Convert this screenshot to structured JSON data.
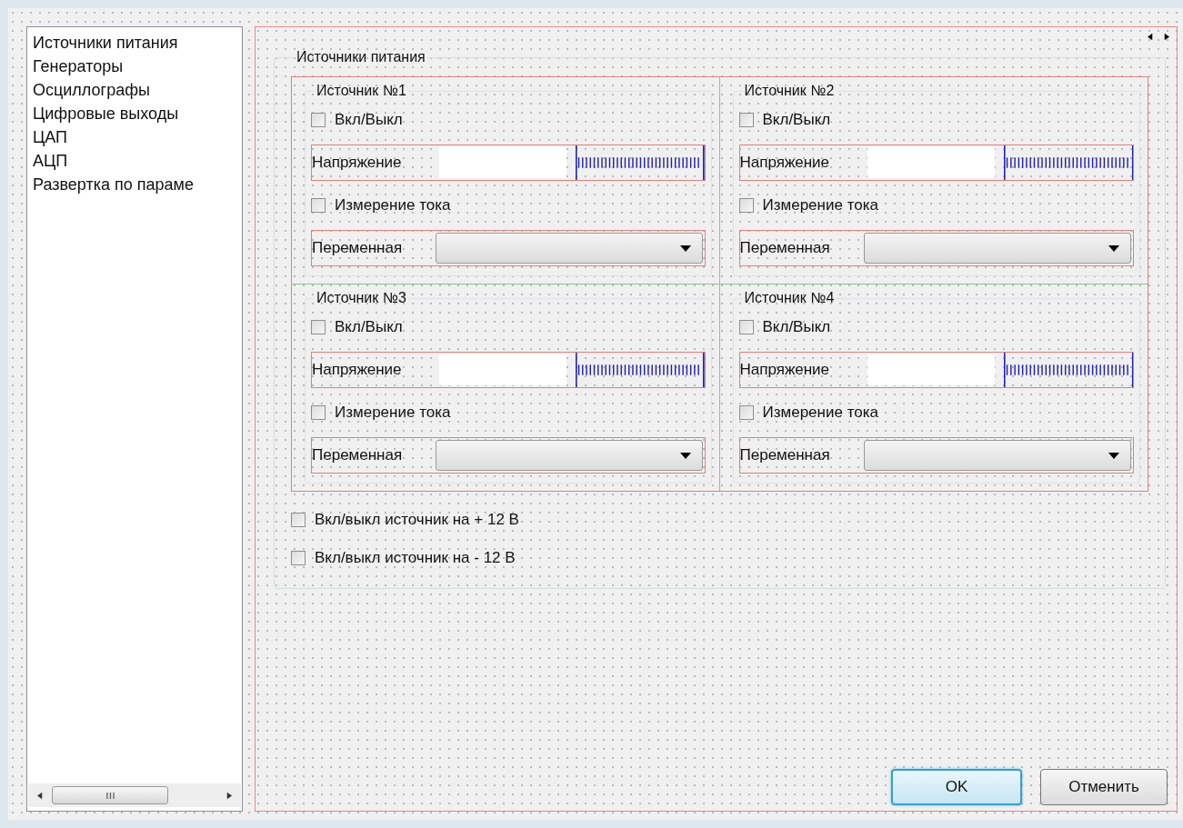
{
  "sidebar": {
    "items": [
      {
        "label": "Источники питания"
      },
      {
        "label": "Генераторы"
      },
      {
        "label": "Осциллографы"
      },
      {
        "label": "Цифровые выходы"
      },
      {
        "label": "ЦАП"
      },
      {
        "label": "АЦП"
      },
      {
        "label": "Развертка по параме"
      }
    ]
  },
  "group": {
    "title": "Источники питания",
    "sources": [
      {
        "title": "Источник №1",
        "power": {
          "label": "Вкл/Выкл",
          "checked": false
        },
        "voltage_label": "Напряжение",
        "current": {
          "label": "Измерение тока",
          "checked": false
        },
        "variable_label": "Переменная"
      },
      {
        "title": "Источник №2",
        "power": {
          "label": "Вкл/Выкл",
          "checked": false
        },
        "voltage_label": "Напряжение",
        "current": {
          "label": "Измерение тока",
          "checked": false
        },
        "variable_label": "Переменная"
      },
      {
        "title": "Источник №3",
        "power": {
          "label": "Вкл/Выкл",
          "checked": false
        },
        "voltage_label": "Напряжение",
        "current": {
          "label": "Измерение тока",
          "checked": false
        },
        "variable_label": "Переменная"
      },
      {
        "title": "Источник №4",
        "power": {
          "label": "Вкл/Выкл",
          "checked": false
        },
        "voltage_label": "Напряжение",
        "current": {
          "label": "Измерение тока",
          "checked": false
        },
        "variable_label": "Переменная"
      }
    ],
    "options": [
      {
        "label": "Вкл/выкл источник на + 12 В",
        "checked": false
      },
      {
        "label": "Вкл/выкл источник на - 12 В",
        "checked": false
      }
    ]
  },
  "buttons": [
    {
      "label": "OK",
      "default": true
    },
    {
      "label": "Отменить",
      "default": false
    }
  ]
}
